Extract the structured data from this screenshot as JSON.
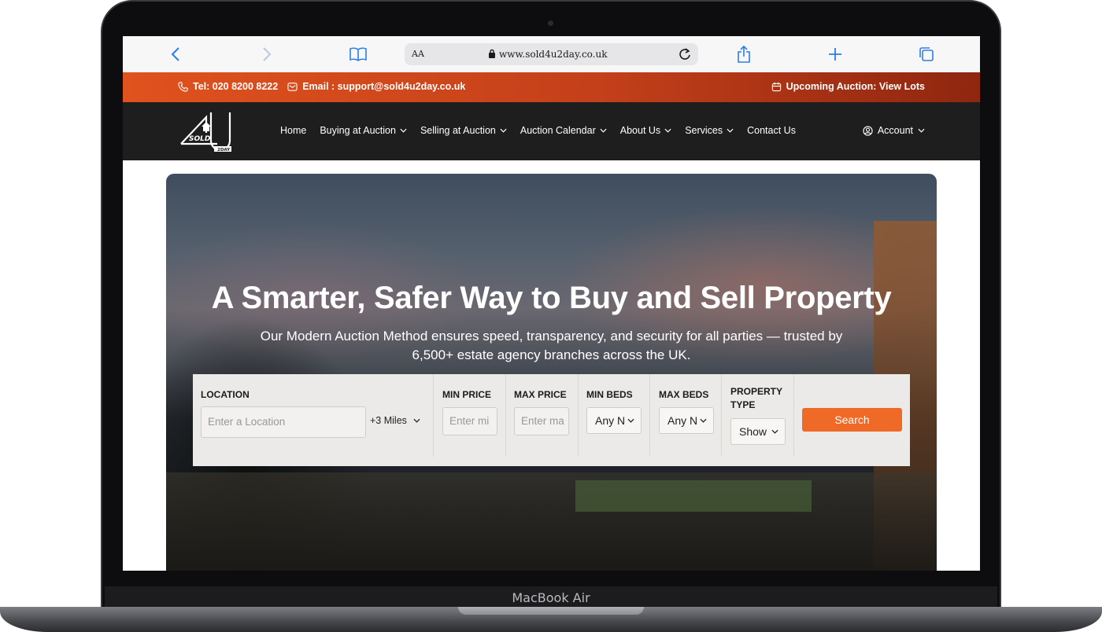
{
  "device": {
    "label": "MacBook Air"
  },
  "browser": {
    "text_size": "AA",
    "url": "www.sold4u2day.co.uk"
  },
  "infobar": {
    "phone": "Tel: 020 8200 8222",
    "email": "Email : support@sold4u2day.co.uk",
    "upcoming": "Upcoming Auction: View Lots"
  },
  "nav": {
    "items": [
      {
        "label": "Home",
        "dropdown": false
      },
      {
        "label": "Buying at Auction",
        "dropdown": true
      },
      {
        "label": "Selling at Auction",
        "dropdown": true
      },
      {
        "label": "Auction Calendar",
        "dropdown": true
      },
      {
        "label": "About Us",
        "dropdown": true
      },
      {
        "label": "Services",
        "dropdown": true
      },
      {
        "label": "Contact Us",
        "dropdown": false
      }
    ],
    "account": "Account"
  },
  "hero": {
    "title": "A Smarter, Safer Way to Buy and Sell Property",
    "subtitle": "Our Modern Auction Method ensures speed, transparency, and security for all parties — trusted by 6,500+ estate agency branches across the UK."
  },
  "search": {
    "location_label": "LOCATION",
    "location_placeholder": "Enter a Location",
    "radius": "+3 Miles",
    "min_price_label": "MIN PRICE",
    "min_price_placeholder": "Enter mi",
    "max_price_label": "MAX PRICE",
    "max_price_placeholder": "Enter ma",
    "min_beds_label": "MIN BEDS",
    "min_beds_value": "Any N",
    "max_beds_label": "MAX BEDS",
    "max_beds_value": "Any N",
    "property_type_label": "PROPERTY TYPE",
    "property_type_value": "Show",
    "button": "Search"
  },
  "colors": {
    "accent": "#ef6a26",
    "infobar_start": "#e0521e",
    "infobar_end": "#8f260f",
    "nav_bg": "#1e1e1e",
    "browser_blue": "#2c7de5"
  }
}
